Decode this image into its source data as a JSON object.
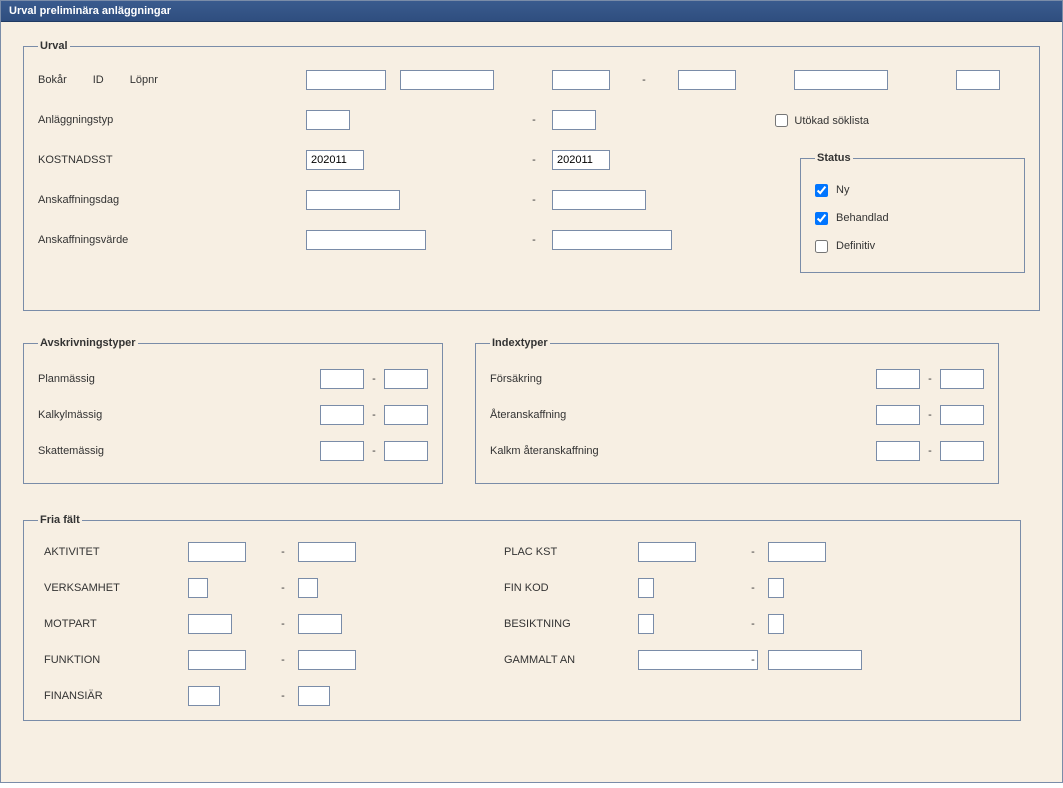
{
  "window": {
    "title": "Urval preliminära anläggningar"
  },
  "urval": {
    "legend": "Urval",
    "labels": {
      "bokar": "Bokår",
      "id": "ID",
      "lopnr": "Löpnr",
      "anlaggningstyp": "Anläggningstyp",
      "kostnadsst": "KOSTNADSST",
      "anskaffningsdag": "Anskaffningsdag",
      "anskaffningsvarde": "Anskaffningsvärde"
    },
    "kostnadsst_from": "202011",
    "kostnadsst_to": "202011",
    "utokad_soklista": "Utökad söklista",
    "utokad_checked": false,
    "sep": "-"
  },
  "status": {
    "legend": "Status",
    "ny": "Ny",
    "behandlad": "Behandlad",
    "definitiv": "Definitiv",
    "ny_checked": true,
    "behandlad_checked": true,
    "definitiv_checked": false
  },
  "avskriv": {
    "legend": "Avskrivningstyper",
    "planmassig": "Planmässig",
    "kalkylmassig": "Kalkylmässig",
    "skattemassig": "Skattemässig",
    "sep": "-"
  },
  "indext": {
    "legend": "Indextyper",
    "forsakring": "Försäkring",
    "ateranskaffning": "Återanskaffning",
    "kalkm": "Kalkm återanskaffning",
    "sep": "-"
  },
  "fria": {
    "legend": "Fria fält",
    "sep": "-",
    "aktivitet": "AKTIVITET",
    "verksamhet": "VERKSAMHET",
    "motpart": "MOTPART",
    "funktion": "FUNKTION",
    "finansiar": "FINANSIÄR",
    "plac_kst": "PLAC KST",
    "fin_kod": "FIN KOD",
    "besiktning": "BESIKTNING",
    "gammalt_an": "GAMMALT AN"
  }
}
